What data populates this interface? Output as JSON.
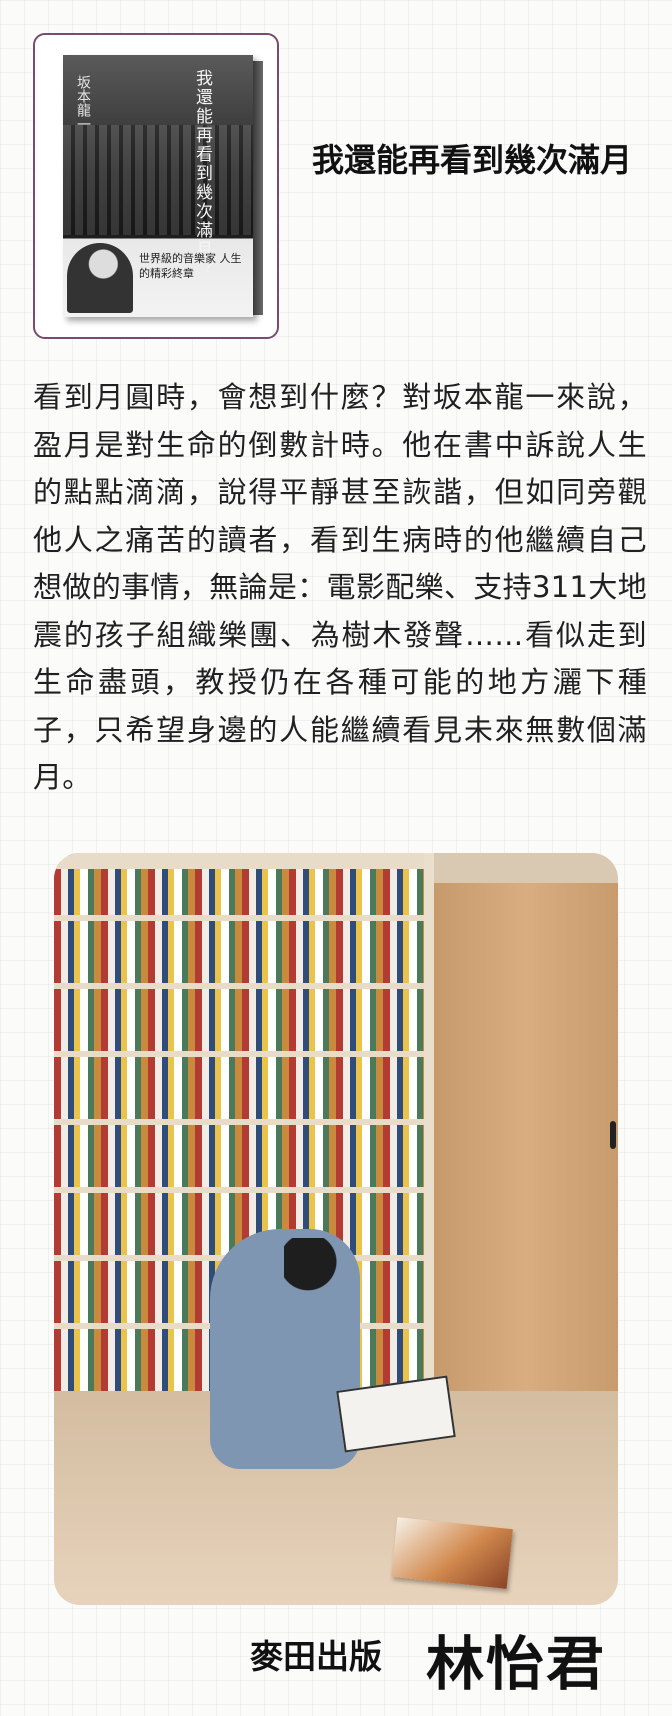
{
  "book": {
    "title": "我還能再看到幾次滿月",
    "cover_title": "我還能再看到幾次滿月？",
    "cover_author": "坂本龍一",
    "cover_tagline": "世界級的音樂家 人生的精彩終章"
  },
  "review": {
    "body": "看到月圓時，會想到什麼？對坂本龍一來說，盈月是對生命的倒數計時。他在書中訴說人生的點點滴滴，說得平靜甚至詼諧，但如同旁觀他人之痛苦的讀者，看到生病時的他繼續自己想做的事情，無論是：電影配樂、支持311大地震的孩子組織樂團、為樹木發聲……看似走到生命盡頭，教授仍在各種可能的地方灑下種子，只希望身邊的人能繼續看見未來無數個滿月。"
  },
  "footer": {
    "publisher": "麥田出版",
    "author": "林怡君"
  },
  "colors": {
    "frame": "#7b4a6e",
    "text": "#202020"
  }
}
